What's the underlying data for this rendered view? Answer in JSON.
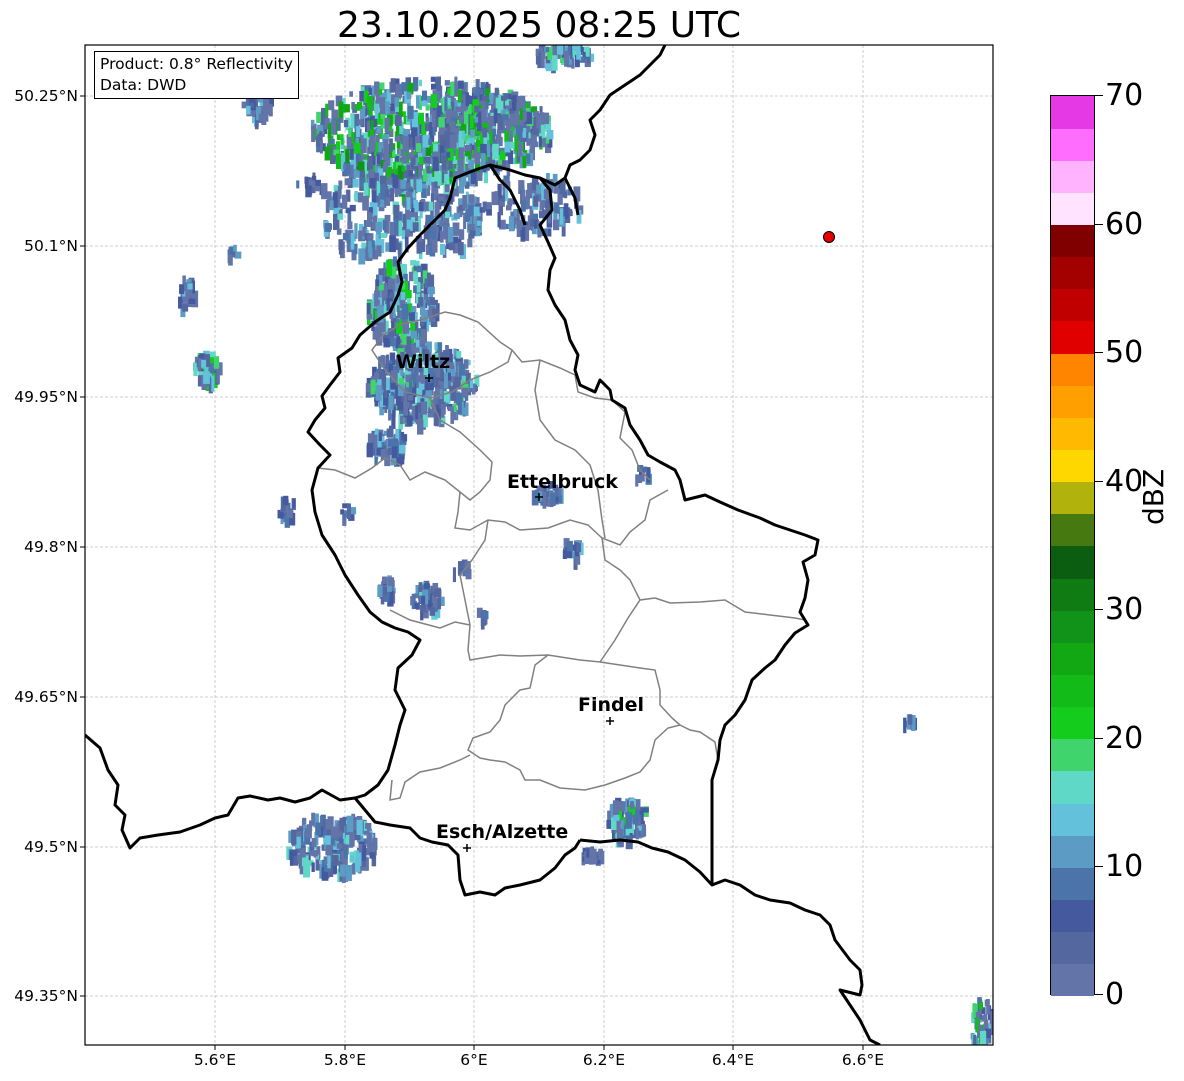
{
  "title": "23.10.2025 08:25 UTC",
  "info": {
    "product": "Product: 0.8° Reflectivity",
    "data": "Data: DWD"
  },
  "colorbar": {
    "unit": "dBZ",
    "ticks": [
      "70",
      "60",
      "50",
      "40",
      "30",
      "20",
      "10",
      "0"
    ],
    "colors": [
      "#6274a8",
      "#55679f",
      "#45599f",
      "#4b74aa",
      "#5b9bc4",
      "#63c1dc",
      "#5fd8c7",
      "#3fd46c",
      "#14cc1c",
      "#13bb18",
      "#12a813",
      "#11931a",
      "#0e7c12",
      "#0b5e10",
      "#467a10",
      "#b1b20b",
      "#ffd700",
      "#ffba00",
      "#ffa000",
      "#ff8400",
      "#e10000",
      "#c00000",
      "#a30000",
      "#800000",
      "#ffe3ff",
      "#ffb3ff",
      "#ff6dff",
      "#e639e6"
    ]
  },
  "axes": {
    "lat_labels": [
      "50.25°N",
      "50.1°N",
      "49.95°N",
      "49.8°N",
      "49.65°N",
      "49.5°N",
      "49.35°N"
    ],
    "lon_labels": [
      "5.6°E",
      "5.8°E",
      "6°E",
      "6.2°E",
      "6.4°E",
      "6.6°E"
    ]
  },
  "cities": [
    {
      "name": "Wiltz"
    },
    {
      "name": "Ettelbruck"
    },
    {
      "name": "Findel"
    },
    {
      "name": "Esch/Alzette"
    }
  ],
  "marker": {
    "color": "#e60000"
  }
}
